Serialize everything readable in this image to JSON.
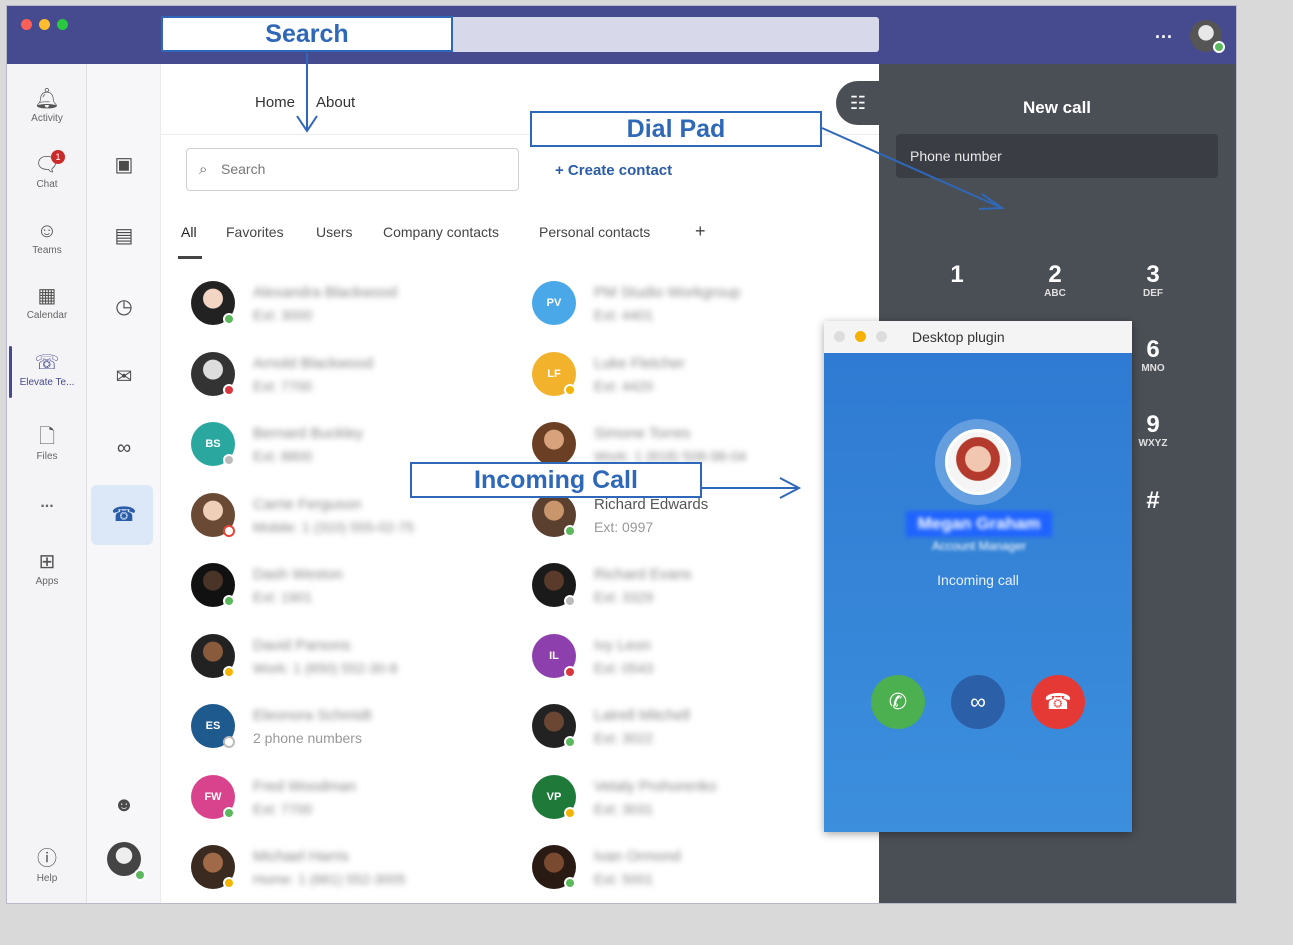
{
  "titlebar": {
    "more_label": "..."
  },
  "rail": {
    "items": [
      {
        "label": "Activity",
        "icon": "bell-icon"
      },
      {
        "label": "Chat",
        "icon": "chat-icon",
        "badge": "1"
      },
      {
        "label": "Teams",
        "icon": "teams-icon"
      },
      {
        "label": "Calendar",
        "icon": "calendar-icon"
      },
      {
        "label": "Elevate Te...",
        "icon": "phone-icon"
      },
      {
        "label": "Files",
        "icon": "file-icon"
      },
      {
        "label": "...",
        "icon": "more-icon"
      },
      {
        "label": "Apps",
        "icon": "apps-icon"
      },
      {
        "label": "Help",
        "icon": "help-icon"
      }
    ]
  },
  "main": {
    "nav": {
      "home": "Home",
      "about": "About"
    },
    "search_placeholder": "Search",
    "create_contact": "+ Create contact",
    "tabs": [
      "All",
      "Favorites",
      "Users",
      "Company contacts",
      "Personal contacts",
      "+"
    ],
    "contacts_left": [
      {
        "name": "Alexandra Blackwood",
        "sub": "Ext: 3000"
      },
      {
        "name": "Arnold Blackwood",
        "sub": "Ext: 7700"
      },
      {
        "name": "Bernard Buckley",
        "sub": "Ext: 8800",
        "initials": "BS"
      },
      {
        "name": "Carrie Ferguson",
        "sub": "Mobile: 1 (310) 555-02-75"
      },
      {
        "name": "Dash Weston",
        "sub": "Ext: 1901"
      },
      {
        "name": "David Parsons",
        "sub": "Work: 1 (650) 552-30-8"
      },
      {
        "name": "Eleonora Schmidt",
        "sub": "2 phone numbers",
        "initials": "ES"
      },
      {
        "name": "Fred Woodman",
        "sub": "Ext: 7700",
        "initials": "FW"
      },
      {
        "name": "Michael Harris",
        "sub": "Home: 1 (661) 552-3005"
      }
    ],
    "contacts_right": [
      {
        "name": "PM Studio Workgroup",
        "sub": "Ext: 4401",
        "initials": "PV"
      },
      {
        "name": "Luke Fletcher",
        "sub": "Ext: 4420",
        "initials": "LF"
      },
      {
        "name": "Simone Torres",
        "sub": "Work: 1 (818) 508-98-04"
      },
      {
        "name": "Richard Edwards",
        "sub": "Ext: 0997"
      },
      {
        "name": "Richard Evans",
        "sub": "Ext: 3329"
      },
      {
        "name": "Ivy Leon",
        "sub": "Ext: 0543",
        "initials": "IL"
      },
      {
        "name": "Latrell Mitchell",
        "sub": "Ext: 3022"
      },
      {
        "name": "Vetaly Prohorenko",
        "sub": "Ext: 3031",
        "initials": "VP"
      },
      {
        "name": "Ivan Ormond",
        "sub": "Ext: 5001"
      }
    ]
  },
  "dialer": {
    "title": "New call",
    "phone_placeholder": "Phone number",
    "keys": [
      {
        "digit": "1",
        "letters": ""
      },
      {
        "digit": "2",
        "letters": "ABC"
      },
      {
        "digit": "3",
        "letters": "DEF"
      },
      {
        "digit": "6",
        "letters": "MNO"
      },
      {
        "digit": "9",
        "letters": "WXYZ"
      },
      {
        "digit": "#",
        "letters": ""
      }
    ]
  },
  "plugin": {
    "title": "Desktop plugin",
    "caller_name": "Megan Graham",
    "caller_role": "Account Manager",
    "status": "Incoming call"
  },
  "annotations": {
    "search": "Search",
    "dialpad": "Dial Pad",
    "incoming": "Incoming Call"
  },
  "colors": {
    "titlebar": "#464a8e",
    "accent": "#2a5ca8",
    "dialer_bg": "#4a4e55",
    "plugin_bg": "#3583d8",
    "accept": "#4caf50",
    "decline": "#e53935",
    "voicemail": "#2b5fa8",
    "annotation": "#2f68b8"
  }
}
